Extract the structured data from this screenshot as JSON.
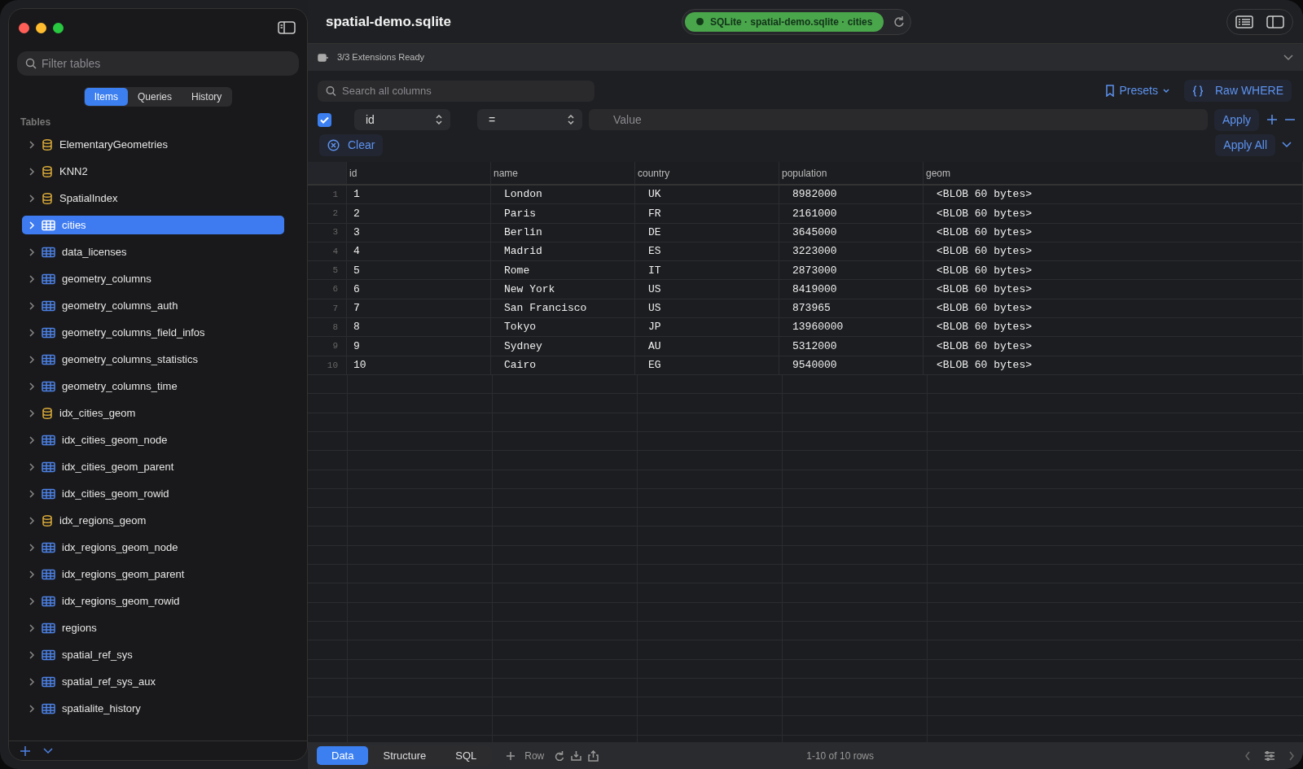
{
  "window": {
    "title": "spatial-demo.sqlite"
  },
  "connection": {
    "label": "SQLite · spatial-demo.sqlite · cities",
    "connected": true
  },
  "sidebar": {
    "filter_placeholder": "Filter tables",
    "tabs": [
      {
        "label": "Items",
        "selected": true
      },
      {
        "label": "Queries",
        "selected": false
      },
      {
        "label": "History",
        "selected": false
      }
    ],
    "section": "Tables",
    "items": [
      {
        "label": "ElementaryGeometries",
        "kind": "view",
        "selected": false,
        "expanded": false
      },
      {
        "label": "KNN2",
        "kind": "view",
        "selected": false,
        "expanded": false
      },
      {
        "label": "SpatialIndex",
        "kind": "view",
        "selected": false,
        "expanded": false
      },
      {
        "label": "cities",
        "kind": "table",
        "selected": true,
        "expanded": false
      },
      {
        "label": "data_licenses",
        "kind": "table",
        "selected": false,
        "expanded": false
      },
      {
        "label": "geometry_columns",
        "kind": "table",
        "selected": false,
        "expanded": false
      },
      {
        "label": "geometry_columns_auth",
        "kind": "table",
        "selected": false,
        "expanded": false
      },
      {
        "label": "geometry_columns_field_infos",
        "kind": "table",
        "selected": false,
        "expanded": false
      },
      {
        "label": "geometry_columns_statistics",
        "kind": "table",
        "selected": false,
        "expanded": false
      },
      {
        "label": "geometry_columns_time",
        "kind": "table",
        "selected": false,
        "expanded": false
      },
      {
        "label": "idx_cities_geom",
        "kind": "view",
        "selected": false,
        "expanded": false
      },
      {
        "label": "idx_cities_geom_node",
        "kind": "table",
        "selected": false,
        "expanded": false
      },
      {
        "label": "idx_cities_geom_parent",
        "kind": "table",
        "selected": false,
        "expanded": false
      },
      {
        "label": "idx_cities_geom_rowid",
        "kind": "table",
        "selected": false,
        "expanded": false
      },
      {
        "label": "idx_regions_geom",
        "kind": "view",
        "selected": false,
        "expanded": false
      },
      {
        "label": "idx_regions_geom_node",
        "kind": "table",
        "selected": false,
        "expanded": false
      },
      {
        "label": "idx_regions_geom_parent",
        "kind": "table",
        "selected": false,
        "expanded": false
      },
      {
        "label": "idx_regions_geom_rowid",
        "kind": "table",
        "selected": false,
        "expanded": false
      },
      {
        "label": "regions",
        "kind": "table",
        "selected": false,
        "expanded": false
      },
      {
        "label": "spatial_ref_sys",
        "kind": "table",
        "selected": false,
        "expanded": false
      },
      {
        "label": "spatial_ref_sys_aux",
        "kind": "table",
        "selected": false,
        "expanded": false
      },
      {
        "label": "spatialite_history",
        "kind": "table",
        "selected": false,
        "expanded": false
      }
    ]
  },
  "extensions": {
    "label": "3/3 Extensions Ready"
  },
  "toolbar": {
    "search_placeholder": "Search all columns",
    "presets": "Presets",
    "raw_where": "Raw WHERE"
  },
  "filter": {
    "enabled": true,
    "column": "id",
    "operator": "=",
    "value_placeholder": "Value",
    "apply": "Apply",
    "clear": "Clear",
    "apply_all": "Apply All"
  },
  "table": {
    "columns": [
      "id",
      "name",
      "country",
      "population",
      "geom"
    ],
    "rows": [
      {
        "number": "1",
        "cells": [
          "1",
          "London",
          "UK",
          "8982000",
          "<BLOB 60 bytes>"
        ]
      },
      {
        "number": "2",
        "cells": [
          "2",
          "Paris",
          "FR",
          "2161000",
          "<BLOB 60 bytes>"
        ]
      },
      {
        "number": "3",
        "cells": [
          "3",
          "Berlin",
          "DE",
          "3645000",
          "<BLOB 60 bytes>"
        ]
      },
      {
        "number": "4",
        "cells": [
          "4",
          "Madrid",
          "ES",
          "3223000",
          "<BLOB 60 bytes>"
        ]
      },
      {
        "number": "5",
        "cells": [
          "5",
          "Rome",
          "IT",
          "2873000",
          "<BLOB 60 bytes>"
        ]
      },
      {
        "number": "6",
        "cells": [
          "6",
          "New York",
          "US",
          "8419000",
          "<BLOB 60 bytes>"
        ]
      },
      {
        "number": "7",
        "cells": [
          "7",
          "San Francisco",
          "US",
          "873965",
          "<BLOB 60 bytes>"
        ]
      },
      {
        "number": "8",
        "cells": [
          "8",
          "Tokyo",
          "JP",
          "13960000",
          "<BLOB 60 bytes>"
        ]
      },
      {
        "number": "9",
        "cells": [
          "9",
          "Sydney",
          "AU",
          "5312000",
          "<BLOB 60 bytes>"
        ]
      },
      {
        "number": "10",
        "cells": [
          "10",
          "Cairo",
          "EG",
          "9540000",
          "<BLOB 60 bytes>"
        ]
      }
    ]
  },
  "footer": {
    "tabs": [
      {
        "label": "Data",
        "selected": true
      },
      {
        "label": "Structure",
        "selected": false
      },
      {
        "label": "SQL",
        "selected": false
      }
    ],
    "add_row": "Row",
    "status": "1-10 of 10 rows"
  }
}
